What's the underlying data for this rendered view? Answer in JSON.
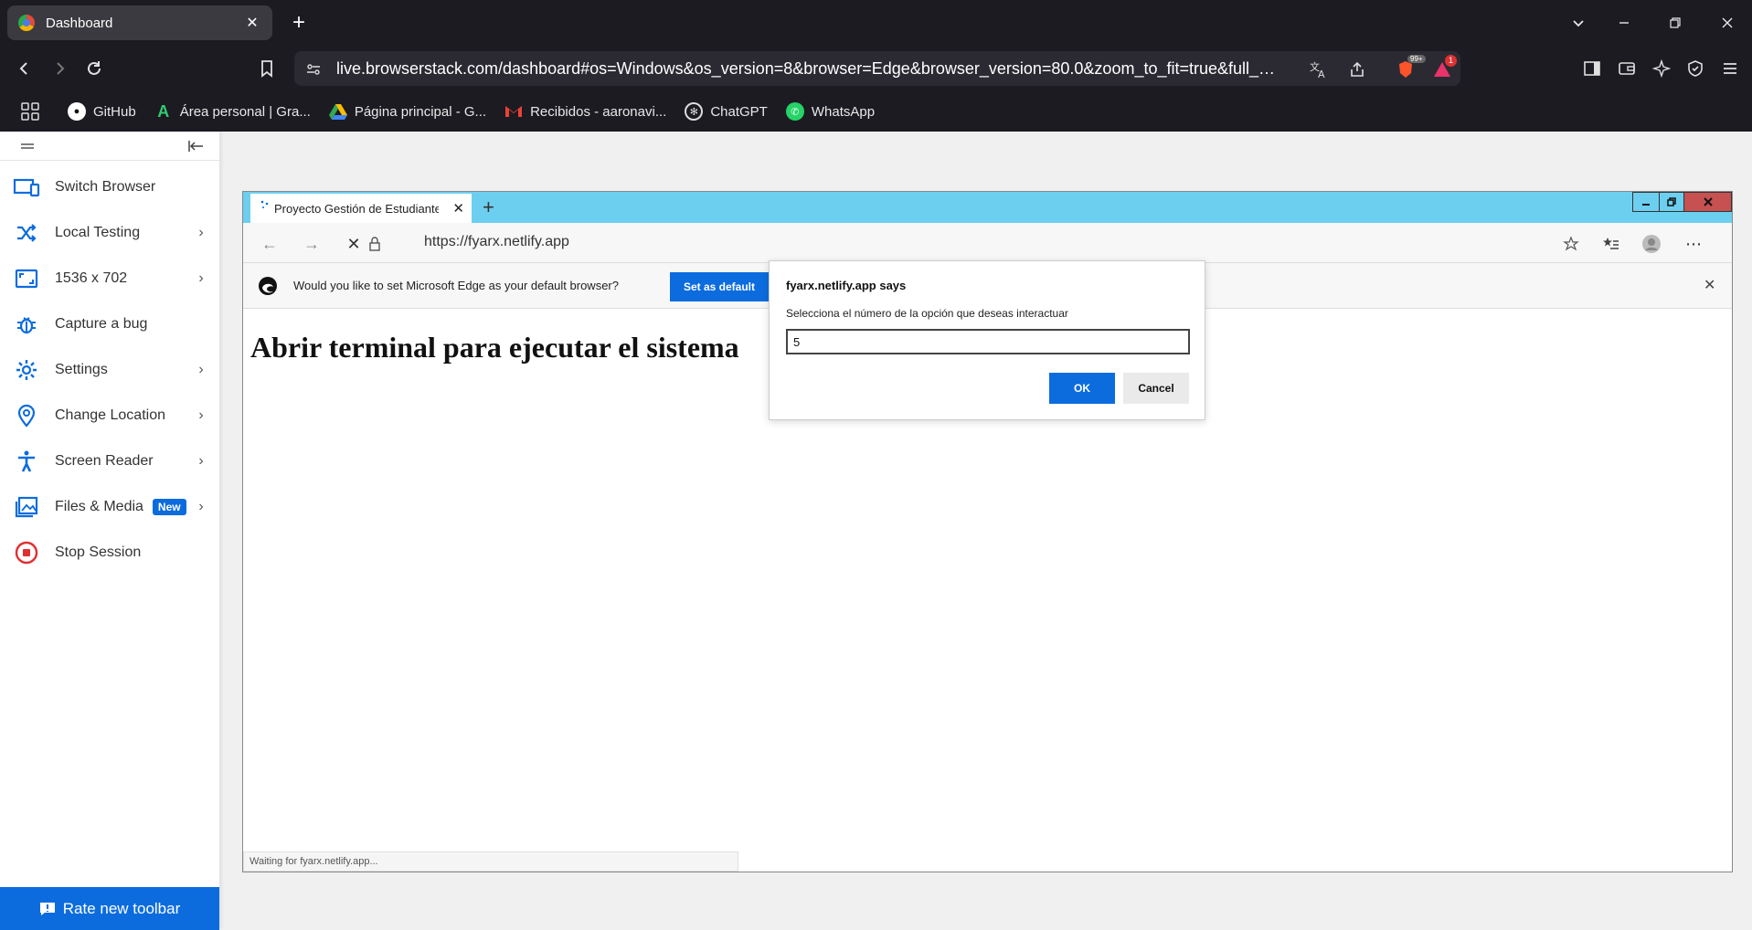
{
  "browser": {
    "tab_title": "Dashboard",
    "tab_close": "✕",
    "new_tab": "+",
    "url": "live.browserstack.com/dashboard#os=Windows&os_version=8&browser=Edge&browser_version=80.0&zoom_to_fit=true&full_scree...",
    "brave_badge": "99+",
    "rewards_badge": "1"
  },
  "bookmarks": [
    {
      "label": "GitHub"
    },
    {
      "label": "Área personal | Gra..."
    },
    {
      "label": "Página principal - G..."
    },
    {
      "label": "Recibidos - aaronavi..."
    },
    {
      "label": "ChatGPT"
    },
    {
      "label": "WhatsApp"
    }
  ],
  "sidebar": {
    "items": [
      {
        "label": "Switch Browser"
      },
      {
        "label": "Local Testing"
      },
      {
        "label": "1536 x 702"
      },
      {
        "label": "Capture a bug"
      },
      {
        "label": "Settings"
      },
      {
        "label": "Change Location"
      },
      {
        "label": "Screen Reader"
      },
      {
        "label": "Files & Media",
        "badge": "New"
      },
      {
        "label": "Stop Session"
      }
    ],
    "chevron": "›",
    "rate_label": "Rate new toolbar"
  },
  "edge": {
    "tab_title": "Proyecto Gestión de Estudiantes",
    "tab_close": "✕",
    "new_tab": "+",
    "url": "https://fyarx.netlify.app",
    "infobar_message": "Would you like to set Microsoft Edge as your default browser?",
    "set_default_label": "Set as default",
    "infobar_close": "✕",
    "page_heading": "Abrir terminal para ejecutar el sistema",
    "status_text": "Waiting for fyarx.netlify.app..."
  },
  "dialog": {
    "title": "fyarx.netlify.app says",
    "message": "Selecciona el número de la opción que deseas interactuar",
    "input_value": "5",
    "ok_label": "OK",
    "cancel_label": "Cancel"
  },
  "colors": {
    "chrome_bg": "#1c1b22",
    "accent_blue": "#0c6cde",
    "edge_tab_strip": "#6ccff0"
  }
}
